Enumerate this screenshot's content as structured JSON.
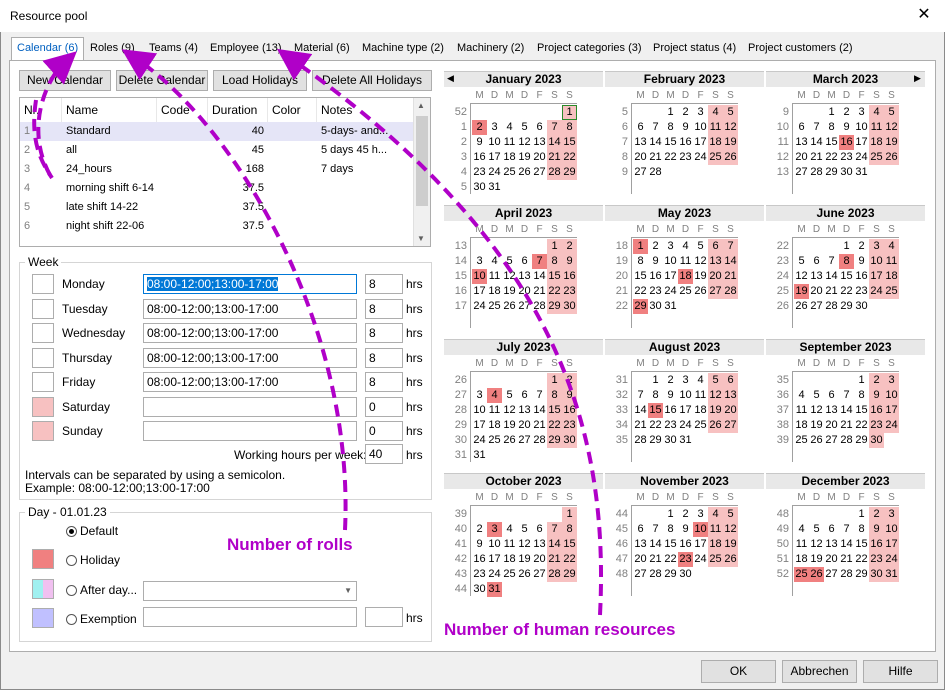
{
  "window": {
    "title": "Resource pool",
    "close_glyph": "✕"
  },
  "tabs": [
    "Calendar (6)",
    "Roles (9)",
    "Teams (4)",
    "Employee (13)",
    "Material (6)",
    "Machine type (2)",
    "Machinery (2)",
    "Project categories (3)",
    "Project status (4)",
    "Project customers (2)"
  ],
  "toolbar": {
    "new": "New Calendar",
    "delete": "Delete Calendar",
    "load": "Load Holidays",
    "delete_all": "Delete All Holidays"
  },
  "grid": {
    "headers": [
      "Nr.",
      "Name",
      "Code",
      "Duration",
      "Color",
      "Notes"
    ],
    "rows": [
      {
        "nr": "1",
        "name": "Standard",
        "code": "",
        "duration": "40",
        "notes": "5-days- and..."
      },
      {
        "nr": "2",
        "name": "all",
        "code": "",
        "duration": "45",
        "notes": "5 days 45 h..."
      },
      {
        "nr": "3",
        "name": "24_hours",
        "code": "",
        "duration": "168",
        "notes": "7 days"
      },
      {
        "nr": "4",
        "name": "morning shift 6-14",
        "code": "",
        "duration": "37.5",
        "notes": ""
      },
      {
        "nr": "5",
        "name": "late shift 14-22",
        "code": "",
        "duration": "37.5",
        "notes": ""
      },
      {
        "nr": "6",
        "name": "night shift 22-06",
        "code": "",
        "duration": "37.5",
        "notes": ""
      }
    ]
  },
  "week": {
    "title": "Week",
    "unit": "hrs",
    "days": [
      {
        "label": "Monday",
        "value": "08:00-12:00;13:00-17:00",
        "hours": "8",
        "holiday": false
      },
      {
        "label": "Tuesday",
        "value": "08:00-12:00;13:00-17:00",
        "hours": "8",
        "holiday": false
      },
      {
        "label": "Wednesday",
        "value": "08:00-12:00;13:00-17:00",
        "hours": "8",
        "holiday": false
      },
      {
        "label": "Thursday",
        "value": "08:00-12:00;13:00-17:00",
        "hours": "8",
        "holiday": false
      },
      {
        "label": "Friday",
        "value": "08:00-12:00;13:00-17:00",
        "hours": "8",
        "holiday": false
      },
      {
        "label": "Saturday",
        "value": "",
        "hours": "0",
        "holiday": true
      },
      {
        "label": "Sunday",
        "value": "",
        "hours": "0",
        "holiday": true
      }
    ],
    "working_hours_label": "Working hours per week:",
    "working_hours_value": "40",
    "hint1": "Intervals can be separated by using a semicolon.",
    "hint2": "Example: 08:00-12:00;13:00-17:00"
  },
  "day": {
    "title": "Day - 01.01.23",
    "default": "Default",
    "holiday": "Holiday",
    "after_day": "After day...",
    "exemption": "Exemption",
    "unit": "hrs"
  },
  "calendar": {
    "year": 2023,
    "dow": [
      "M",
      "D",
      "M",
      "D",
      "F",
      "S",
      "S"
    ],
    "months": [
      "January 2023",
      "February 2023",
      "March 2023",
      "April 2023",
      "May 2023",
      "June 2023",
      "July 2023",
      "August 2023",
      "September 2023",
      "October 2023",
      "November 2023",
      "December 2023"
    ],
    "holidays": [
      "1-2",
      "3-16",
      "4-7",
      "4-10",
      "5-1",
      "5-18",
      "5-29",
      "6-8",
      "6-19",
      "7-4",
      "8-15",
      "10-3",
      "10-31",
      "11-10",
      "11-23",
      "12-25",
      "12-26"
    ],
    "selected": "1-1",
    "prev_icon": "◀",
    "next_icon": "▶"
  },
  "annotations": {
    "rolls": "Number of rolls",
    "human": "Number of human resources"
  },
  "footer": {
    "ok": "OK",
    "cancel": "Abbrechen",
    "help": "Hilfe"
  },
  "colors": {
    "holiday": "#f08080",
    "weekend": "#f7c1c1",
    "active_tab": "#0060c0",
    "annotation": "#b000c8",
    "selected_row": "#e5e5f7",
    "exemption": "#c0c0ff"
  }
}
